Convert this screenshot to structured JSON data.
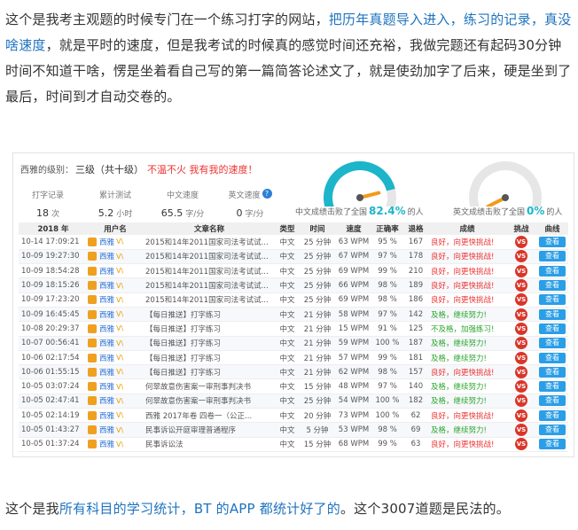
{
  "article": {
    "p1_a": "这个是我考主观题的时候专门在一个练习打字的网站，",
    "p1_link": "把历年真题导入进入，练习的记录，真没啥速度",
    "p1_b": "，就是平时的速度，但是我考试的时候真的感觉时间还充裕，我做完题还有起码30分钟时间不知道干啥，愣是坐着看自己写的第一篇简答论述文了，就是使劲加字了后来，硬是坐到了最后，时间到才自动交卷的。",
    "p2_a": "这个是我",
    "p2_link": "所有科目的学习统计，BT 的APP 都统计好了的",
    "p2_b": "。这个3007道题是民法的。"
  },
  "screenshot": {
    "level_label": "西雅的级别：",
    "level_value": "三级（共十级）",
    "slogan": "不温不火 我有我的速度！",
    "stats": [
      {
        "label": "打字记录",
        "value": "18",
        "unit": "次"
      },
      {
        "label": "累计测试",
        "value": "5.2",
        "unit": "小时"
      },
      {
        "label": "中文速度",
        "value": "65.5",
        "unit": "字/分"
      },
      {
        "label": "英文速度",
        "value": "0",
        "unit": "字/分"
      }
    ],
    "info_icon": "?",
    "gauges": [
      {
        "pre": "中文成绩击败了全国",
        "pct": "82.4%",
        "post": "的人",
        "fraction": 0.824,
        "color": "#1cb5c9"
      },
      {
        "pre": "英文成绩击败了全国",
        "pct": "0%",
        "post": "的人",
        "fraction": 0.0,
        "color": "#1cb5c9"
      }
    ],
    "table": {
      "headers": [
        "2018 年",
        "用户名",
        "文章名称",
        "类型",
        "时间",
        "速度",
        "正确率",
        "退格",
        "成绩",
        "挑战",
        "曲线"
      ],
      "vip_mark": "V\\",
      "vs_label": "VS",
      "view_label": "查看",
      "rows": [
        {
          "time": "10-14 17:09:21",
          "user": "西雅",
          "title": "2015和14年2011国家司法考试试...",
          "type": "中文",
          "dur": "25 分钟",
          "speed": "63 WPM",
          "acc": "95 %",
          "bs": "167",
          "result": "良好，向更快挑战!",
          "good": false
        },
        {
          "time": "10-09 19:27:30",
          "user": "西雅",
          "title": "2015和14年2011国家司法考试试...",
          "type": "中文",
          "dur": "25 分钟",
          "speed": "67 WPM",
          "acc": "97 %",
          "bs": "178",
          "result": "良好，向更快挑战!",
          "good": false
        },
        {
          "time": "10-09 18:54:28",
          "user": "西雅",
          "title": "2015和14年2011国家司法考试试...",
          "type": "中文",
          "dur": "25 分钟",
          "speed": "69 WPM",
          "acc": "99 %",
          "bs": "210",
          "result": "良好，向更快挑战!",
          "good": false
        },
        {
          "time": "10-09 18:15:26",
          "user": "西雅",
          "title": "2015和14年2011国家司法考试试...",
          "type": "中文",
          "dur": "25 分钟",
          "speed": "66 WPM",
          "acc": "98 %",
          "bs": "189",
          "result": "良好，向更快挑战!",
          "good": false
        },
        {
          "time": "10-09 17:23:20",
          "user": "西雅",
          "title": "2015和14年2011国家司法考试试...",
          "type": "中文",
          "dur": "25 分钟",
          "speed": "69 WPM",
          "acc": "98 %",
          "bs": "186",
          "result": "良好，向更快挑战!",
          "good": false
        },
        {
          "time": "10-09 16:45:45",
          "user": "西雅",
          "title": "【每日推送】打字练习",
          "type": "中文",
          "dur": "21 分钟",
          "speed": "58 WPM",
          "acc": "97 %",
          "bs": "142",
          "result": "及格，继续努力!",
          "good": true
        },
        {
          "time": "10-08 20:29:37",
          "user": "西雅",
          "title": "【每日推送】打字练习",
          "type": "中文",
          "dur": "21 分钟",
          "speed": "15 WPM",
          "acc": "91 %",
          "bs": "125",
          "result": "不及格，加强练习!",
          "good": true
        },
        {
          "time": "10-07 00:56:41",
          "user": "西雅",
          "title": "【每日推送】打字练习",
          "type": "中文",
          "dur": "21 分钟",
          "speed": "59 WPM",
          "acc": "100 %",
          "bs": "187",
          "result": "及格，继续努力!",
          "good": true
        },
        {
          "time": "10-06 02:17:54",
          "user": "西雅",
          "title": "【每日推送】打字练习",
          "type": "中文",
          "dur": "21 分钟",
          "speed": "57 WPM",
          "acc": "99 %",
          "bs": "181",
          "result": "及格，继续努力!",
          "good": true
        },
        {
          "time": "10-06 01:55:15",
          "user": "西雅",
          "title": "【每日推送】打字练习",
          "type": "中文",
          "dur": "21 分钟",
          "speed": "62 WPM",
          "acc": "98 %",
          "bs": "157",
          "result": "良好，向更快挑战!",
          "good": false
        },
        {
          "time": "10-05 03:07:24",
          "user": "西雅",
          "title": "何翠故意伤害案一审刑事判决书",
          "type": "中文",
          "dur": "15 分钟",
          "speed": "48 WPM",
          "acc": "97 %",
          "bs": "140",
          "result": "及格，继续努力!",
          "good": true
        },
        {
          "time": "10-05 02:47:41",
          "user": "西雅",
          "title": "何翠故意伤害案一审刑事判决书",
          "type": "中文",
          "dur": "25 分钟",
          "speed": "54 WPM",
          "acc": "100 %",
          "bs": "182",
          "result": "及格，继续努力!",
          "good": true
        },
        {
          "time": "10-05 02:14:19",
          "user": "西雅",
          "title": "西雅 2017年卷 四卷一（公正...",
          "type": "中文",
          "dur": "20 分钟",
          "speed": "73 WPM",
          "acc": "100 %",
          "bs": "62",
          "result": "良好，向更快挑战!",
          "good": false
        },
        {
          "time": "10-05 01:43:27",
          "user": "西雅",
          "title": "民事诉讼开庭审理普通程序",
          "type": "中文",
          "dur": "5 分钟",
          "speed": "53 WPM",
          "acc": "98 %",
          "bs": "69",
          "result": "及格，继续努力!",
          "good": true
        },
        {
          "time": "10-05 01:37:24",
          "user": "西雅",
          "title": "民事诉讼法",
          "type": "中文",
          "dur": "15 分钟",
          "speed": "68 WPM",
          "acc": "99 %",
          "bs": "63",
          "result": "良好，向更快挑战!",
          "good": false
        }
      ]
    }
  }
}
